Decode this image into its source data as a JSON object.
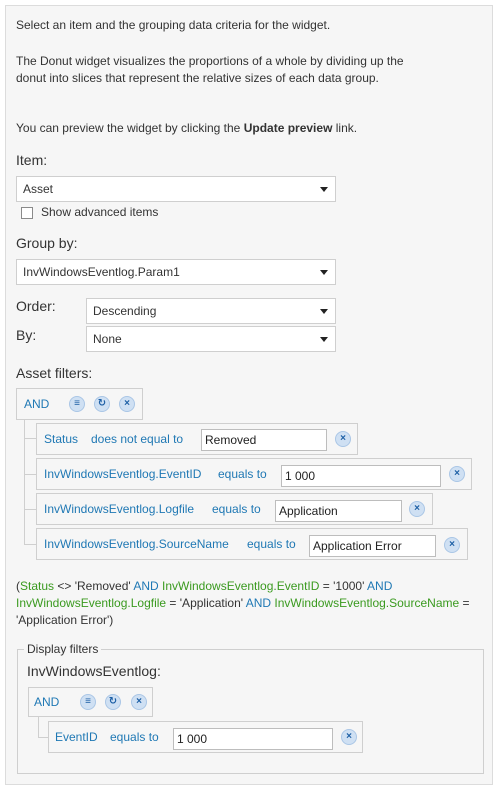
{
  "intro": {
    "line1": "Select an item and the grouping data criteria for the widget.",
    "line2": "The Donut widget visualizes the proportions of a whole by dividing up the donut into slices that represent the relative sizes of each data group.",
    "line3_prefix": "You can preview the widget by clicking the ",
    "line3_bold": "Update preview",
    "line3_suffix": " link."
  },
  "item": {
    "label": "Item:",
    "value": "Asset",
    "show_advanced_label": "Show advanced items",
    "show_advanced_checked": false
  },
  "group_by": {
    "label": "Group by:",
    "value": "InvWindowsEventlog.Param1"
  },
  "order": {
    "label": "Order:",
    "value": "Descending"
  },
  "by": {
    "label": "By:",
    "value": "None"
  },
  "asset_filters": {
    "label": "Asset filters:",
    "operator": "AND",
    "rows": [
      {
        "field": "Status",
        "condition": "does not equal to",
        "value": "Removed"
      },
      {
        "field": "InvWindowsEventlog.EventID",
        "condition": "equals to",
        "value": "1 000"
      },
      {
        "field": "InvWindowsEventlog.Logfile",
        "condition": "equals to",
        "value": "Application"
      },
      {
        "field": "InvWindowsEventlog.SourceName",
        "condition": "equals to",
        "value": "Application Error"
      }
    ]
  },
  "expression": {
    "p1": "(",
    "f1": "Status",
    "t1": " <> 'Removed' ",
    "a1": "AND",
    "f2": " InvWindowsEventlog.EventID",
    "t2": " = '1000' ",
    "a2": "AND",
    "f3": "InvWindowsEventlog.Logfile",
    "t3": " = 'Application' ",
    "a3": "AND",
    "f4": " InvWindowsEventlog.SourceName",
    "t4": " = ",
    "t5": "'Application Error')"
  },
  "display_filters": {
    "legend": "Display filters",
    "table": "InvWindowsEventlog:",
    "operator": "AND",
    "rows": [
      {
        "field": "EventID",
        "condition": "equals to",
        "value": "1 000"
      }
    ]
  },
  "colors": {
    "link": "#1f78b4",
    "expression_field": "#3a9a1f"
  },
  "icons": {
    "group_add": "list-add-icon",
    "condition_add": "refresh-add-icon",
    "remove": "close-icon"
  }
}
